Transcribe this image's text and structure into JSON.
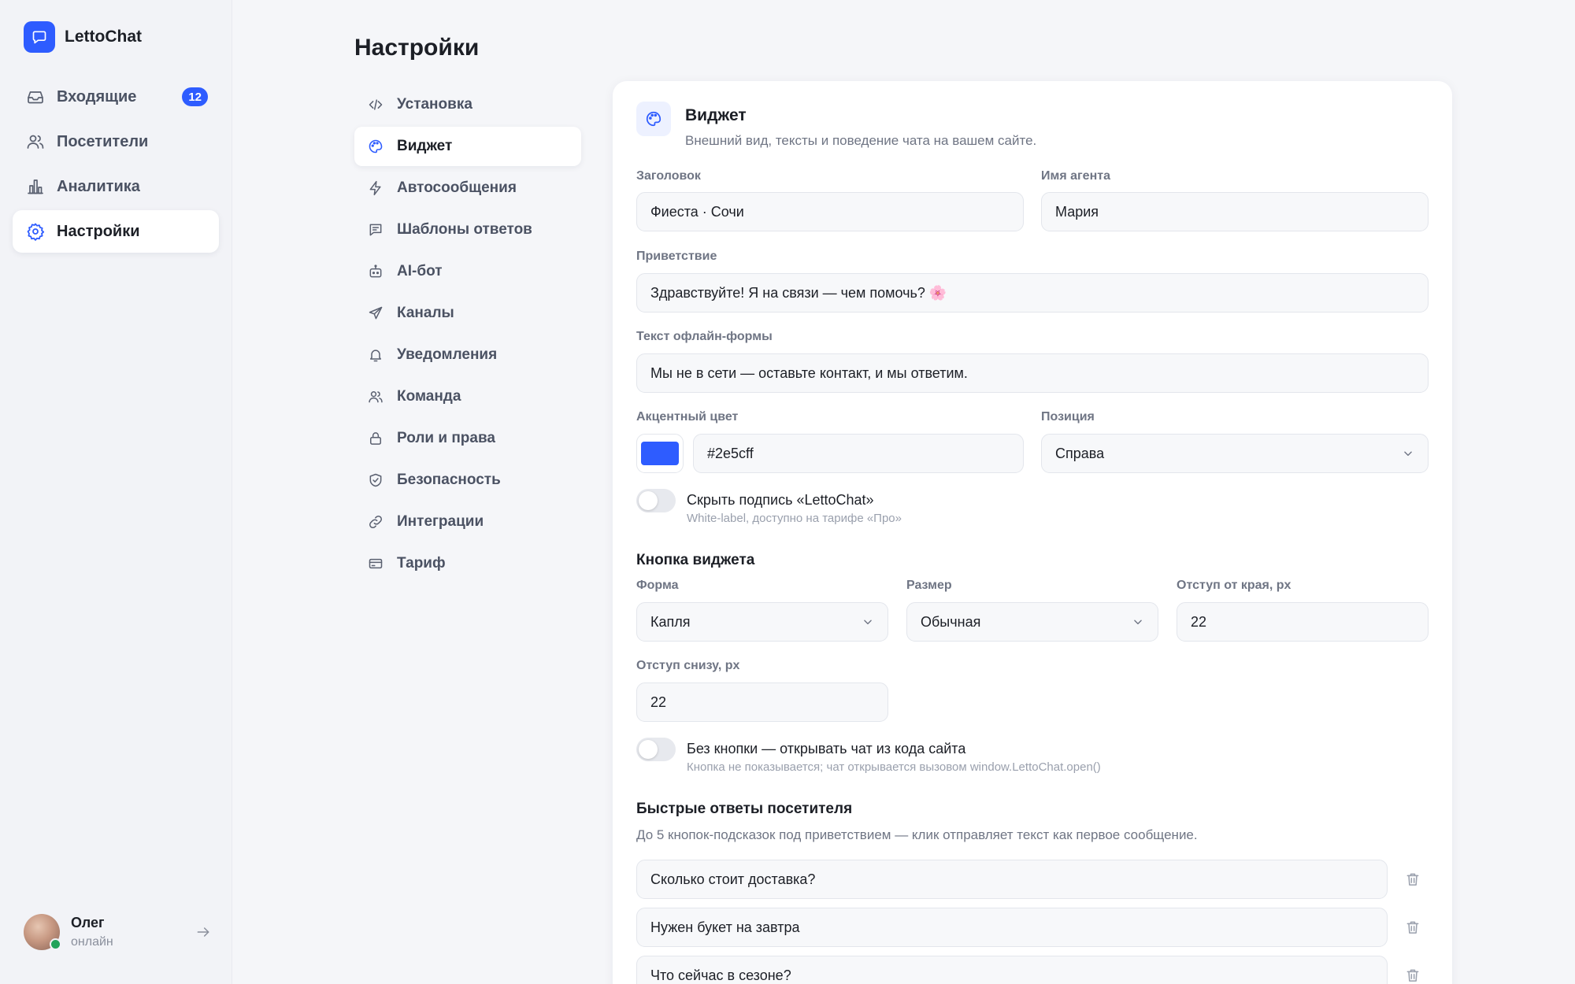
{
  "app": {
    "name": "LettoChat",
    "logo_icon": "chat-bubble-icon",
    "accent": "#2e5cff"
  },
  "sidebar": {
    "items": [
      {
        "label": "Входящие",
        "icon": "inbox-icon",
        "badge": "12"
      },
      {
        "label": "Посетители",
        "icon": "users-icon"
      },
      {
        "label": "Аналитика",
        "icon": "bar-chart-icon"
      },
      {
        "label": "Настройки",
        "icon": "gear-icon",
        "active": true
      }
    ],
    "user": {
      "name": "Олег",
      "status": "онлайн",
      "status_color": "#22a35a"
    }
  },
  "page": {
    "title": "Настройки"
  },
  "submenu": {
    "items": [
      {
        "label": "Установка",
        "icon": "code-icon"
      },
      {
        "label": "Виджет",
        "icon": "palette-icon",
        "active": true
      },
      {
        "label": "Автосообщения",
        "icon": "lightning-icon"
      },
      {
        "label": "Шаблоны ответов",
        "icon": "message-square-icon"
      },
      {
        "label": "AI-бот",
        "icon": "bot-icon"
      },
      {
        "label": "Каналы",
        "icon": "send-icon"
      },
      {
        "label": "Уведомления",
        "icon": "bell-icon"
      },
      {
        "label": "Команда",
        "icon": "team-icon"
      },
      {
        "label": "Роли и права",
        "icon": "lock-icon"
      },
      {
        "label": "Безопасность",
        "icon": "shield-icon"
      },
      {
        "label": "Интеграции",
        "icon": "link-icon"
      },
      {
        "label": "Тариф",
        "icon": "credit-card-icon"
      }
    ]
  },
  "widget": {
    "title": "Виджет",
    "subtitle": "Внешний вид, тексты и поведение чата на вашем сайте.",
    "header_label": "Заголовок",
    "header_value": "Фиеста · Сочи",
    "agent_label": "Имя агента",
    "agent_value": "Мария",
    "greeting_label": "Приветствие",
    "greeting_value": "Здравствуйте! Я на связи — чем помочь? 🌸",
    "offline_label": "Текст офлайн-формы",
    "offline_value": "Мы не в сети — оставьте контакт, и мы ответим.",
    "accent_label": "Акцентный цвет",
    "accent_value": "#2e5cff",
    "position_label": "Позиция",
    "position_value": "Справа",
    "hide_sig_title": "Скрыть подпись «LettoChat»",
    "hide_sig_hint": "White-label, доступно на тарифе «Про»",
    "hide_sig_on": false
  },
  "button_section": {
    "title": "Кнопка виджета",
    "shape_label": "Форма",
    "shape_value": "Капля",
    "size_label": "Размер",
    "size_value": "Обычная",
    "edge_label": "Отступ от края, px",
    "edge_value": "22",
    "bottom_label": "Отступ снизу, px",
    "bottom_value": "22",
    "no_button_title": "Без кнопки — открывать чат из кода сайта",
    "no_button_hint": "Кнопка не показывается; чат открывается вызовом window.LettoChat.open()",
    "no_button_on": false
  },
  "quick_replies": {
    "title": "Быстрые ответы посетителя",
    "desc": "До 5 кнопок-подсказок под приветствием — клик отправляет текст как первое сообщение.",
    "items": [
      "Сколько стоит доставка?",
      "Нужен букет на завтра",
      "Что сейчас в сезоне?"
    ]
  }
}
